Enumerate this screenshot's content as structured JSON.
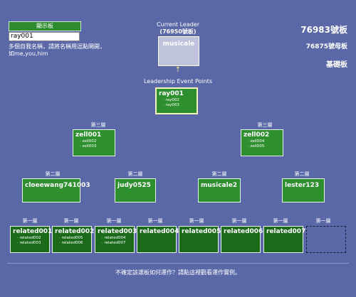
{
  "display": {
    "header": "顯示板",
    "input_value": "ray001",
    "hint_line1": "多個自我名稱，請將名稱用逗點隔開，",
    "hint_line2": "如me,you,him"
  },
  "leader": {
    "title_line1": "Current Leader",
    "title_line2": "(76950號板)",
    "name": "musicale",
    "arrow": "↑",
    "event_points_label": "Leadership Event Points"
  },
  "boards": {
    "main": "76983號板",
    "parent": "76875號母板",
    "base": "基礎板"
  },
  "levels": {
    "level3": "第三層",
    "level2": "第二層",
    "level1": "第一層"
  },
  "tree": {
    "root": {
      "name": "ray001",
      "children": [
        "ray002",
        "ray003"
      ]
    },
    "level3": [
      {
        "name": "zell001",
        "children": [
          "zell002",
          "zell003"
        ]
      },
      {
        "name": "zell002",
        "children": [
          "zell004",
          "zell005"
        ]
      }
    ],
    "level2": [
      {
        "name": "cloeewang741003"
      },
      {
        "name": "judy0525"
      },
      {
        "name": "musicale2"
      },
      {
        "name": "lester123"
      }
    ],
    "level1": [
      {
        "name": "related001",
        "children": [
          "related002",
          "related003"
        ]
      },
      {
        "name": "related002",
        "children": [
          "related005",
          "related006"
        ]
      },
      {
        "name": "related003",
        "children": [
          "related004",
          "related007"
        ]
      },
      {
        "name": "related004"
      },
      {
        "name": "related005"
      },
      {
        "name": "related006"
      },
      {
        "name": "related007"
      }
    ]
  },
  "footer": "不確定該選板如何運作？請點這裡觀看運作實例。"
}
